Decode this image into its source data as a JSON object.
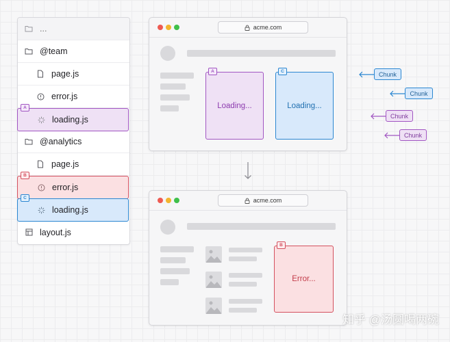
{
  "tree": {
    "rows": [
      {
        "label": "...",
        "icon": "folder-icon"
      },
      {
        "label": "@team",
        "icon": "folder-icon"
      },
      {
        "label": "page.js",
        "icon": "file-icon"
      },
      {
        "label": "error.js",
        "icon": "alert-circle-icon"
      },
      {
        "label": "loading.js",
        "icon": "spinner-icon",
        "badge": "A"
      },
      {
        "label": "@analytics",
        "icon": "folder-icon"
      },
      {
        "label": "page.js",
        "icon": "file-icon"
      },
      {
        "label": "error.js",
        "icon": "alert-circle-icon",
        "badge": "B"
      },
      {
        "label": "loading.js",
        "icon": "spinner-icon",
        "badge": "C"
      },
      {
        "label": "layout.js",
        "icon": "layout-icon"
      }
    ]
  },
  "window_top": {
    "url": "acme.com",
    "panel_a": {
      "badge": "A",
      "text": "Loading..."
    },
    "panel_c": {
      "badge": "C",
      "text": "Loading..."
    }
  },
  "window_bottom": {
    "url": "acme.com",
    "panel_b": {
      "badge": "B",
      "text": "Error..."
    }
  },
  "chunks": [
    "Chunk",
    "Chunk",
    "Chunk",
    "Chunk"
  ],
  "watermark": "知乎 @汤圆喝两碗",
  "colors": {
    "purple": "#a155c2",
    "red": "#d4505e",
    "blue": "#2a86d1"
  }
}
